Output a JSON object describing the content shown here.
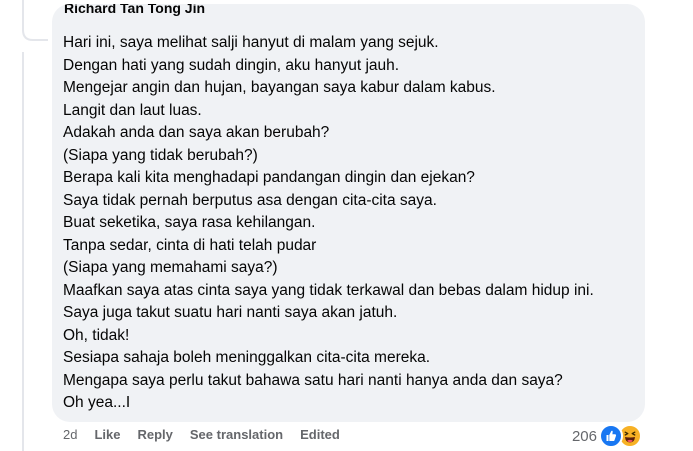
{
  "comment": {
    "author": "Richard Tan Tong Jin",
    "lines": [
      "Hari ini, saya melihat salji hanyut di malam yang sejuk.",
      "Dengan hati yang sudah dingin, aku hanyut jauh.",
      "Mengejar angin dan hujan, bayangan saya kabur dalam kabus.",
      "Langit dan laut luas.",
      "Adakah anda dan saya akan berubah?",
      "(Siapa yang tidak berubah?)",
      "Berapa kali kita menghadapi pandangan dingin dan ejekan?",
      "Saya tidak pernah berputus asa dengan cita-cita saya.",
      "Buat seketika, saya rasa kehilangan.",
      "Tanpa sedar, cinta di hati telah pudar",
      "(Siapa yang memahami saya?)",
      "Maafkan saya atas cinta saya yang tidak terkawal dan bebas dalam hidup ini.",
      "Saya juga takut suatu hari nanti saya akan jatuh.",
      "Oh, tidak!",
      "Sesiapa sahaja boleh meninggalkan cita-cita mereka.",
      "Mengapa saya perlu takut bahawa satu hari nanti hanya anda dan saya?",
      "Oh yea...I"
    ]
  },
  "actions": {
    "time": "2d",
    "like": "Like",
    "reply": "Reply",
    "translate": "See translation",
    "edited": "Edited"
  },
  "reactions": {
    "count": "206",
    "icons": [
      "like-icon",
      "haha-icon"
    ]
  },
  "colors": {
    "bubble": "#f0f2f5",
    "text": "#050505",
    "meta": "#65676b",
    "like_blue": "#1877f2",
    "haha_yellow": "#f7b125"
  }
}
